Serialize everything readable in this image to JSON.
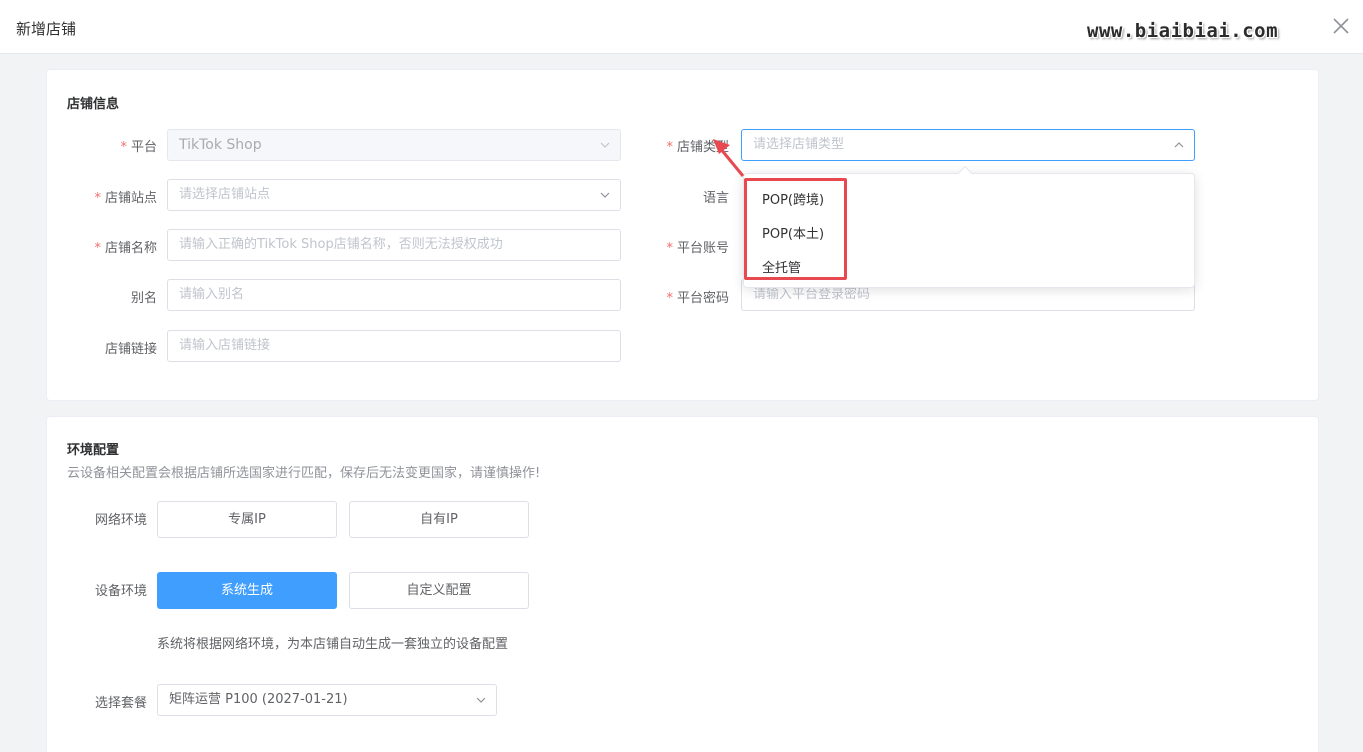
{
  "dialog": {
    "title": "新增店铺",
    "watermark": "www.biaibiai.com",
    "close_icon": "close-icon"
  },
  "store_info": {
    "section_title": "店铺信息",
    "platform": {
      "label": "平台",
      "value": "TikTok Shop"
    },
    "store_type": {
      "label": "店铺类型",
      "placeholder": "请选择店铺类型"
    },
    "site": {
      "label": "店铺站点",
      "placeholder": "请选择店铺站点"
    },
    "language": {
      "label": "语言"
    },
    "store_name": {
      "label": "店铺名称",
      "placeholder": "请输入正确的TikTok Shop店铺名称，否则无法授权成功"
    },
    "account": {
      "label": "平台账号"
    },
    "alias": {
      "label": "别名",
      "placeholder": "请输入别名"
    },
    "password": {
      "label": "平台密码",
      "placeholder": "请输入平台登录密码"
    },
    "link": {
      "label": "店铺链接",
      "placeholder": "请输入店铺链接"
    },
    "required_mark": "*"
  },
  "store_type_dropdown": {
    "options": [
      "POP(跨境)",
      "POP(本土)",
      "全托管"
    ],
    "annotation_color": "#e8484f"
  },
  "env_config": {
    "section_title": "环境配置",
    "description": "云设备相关配置会根据店铺所选国家进行匹配，保存后无法变更国家，请谨慎操作!",
    "network": {
      "label": "网络环境",
      "options": [
        "专属IP",
        "自有IP"
      ]
    },
    "device": {
      "label": "设备环境",
      "options": [
        "系统生成",
        "自定义配置"
      ],
      "selected": "系统生成"
    },
    "device_hint": "系统将根据网络环境，为本店铺自动生成一套独立的设备配置",
    "package": {
      "label": "选择套餐",
      "value": "矩阵运营 P100 (2027-01-21)"
    }
  },
  "colors": {
    "primary": "#409eff",
    "required": "#f56c6c"
  }
}
